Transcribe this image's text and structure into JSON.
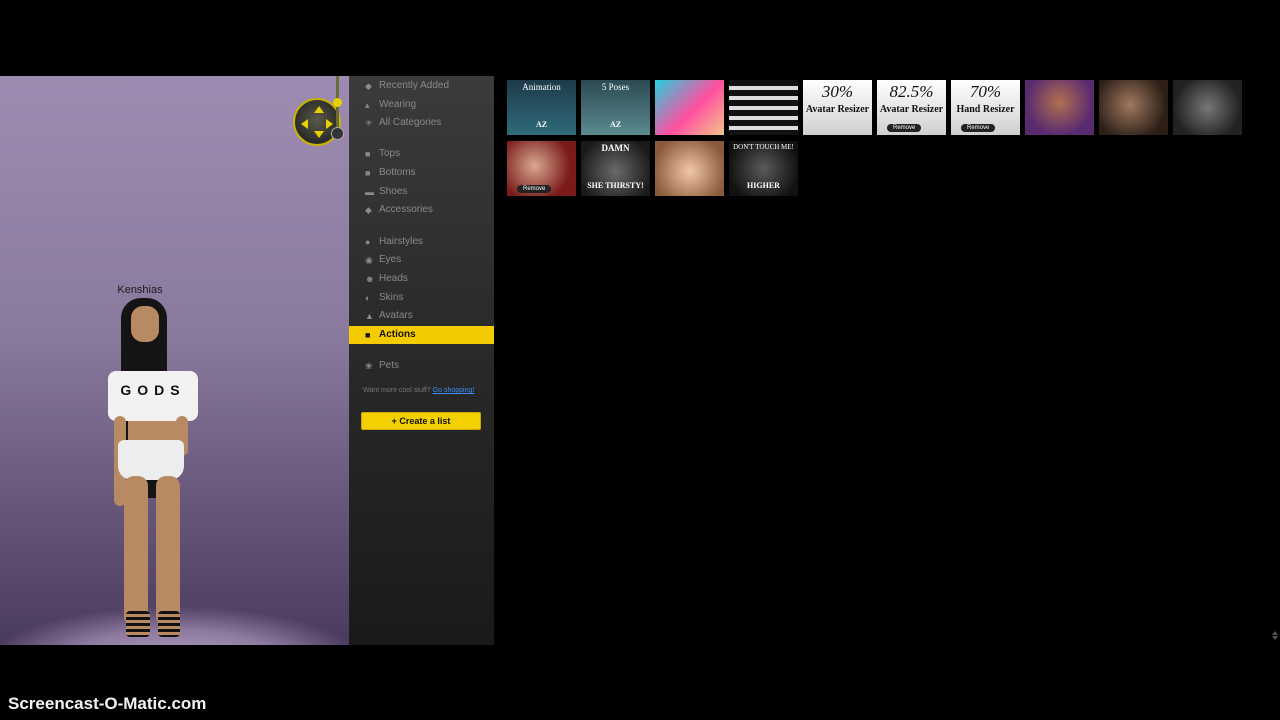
{
  "stage": {
    "avatar_name": "Kenshias",
    "shirt_text": "GODS"
  },
  "sidebar": {
    "items": [
      {
        "label": "Recently Added",
        "icon": "tag-icon"
      },
      {
        "label": "Wearing",
        "icon": "hanger-icon"
      },
      {
        "label": "All Categories",
        "icon": "asterisk-icon"
      },
      {
        "label": "Tops",
        "icon": "shirt-icon"
      },
      {
        "label": "Bottoms",
        "icon": "pants-icon"
      },
      {
        "label": "Shoes",
        "icon": "shoe-icon"
      },
      {
        "label": "Accessories",
        "icon": "diamond-icon"
      },
      {
        "label": "Hairstyles",
        "icon": "hair-icon"
      },
      {
        "label": "Eyes",
        "icon": "eye-icon"
      },
      {
        "label": "Heads",
        "icon": "face-icon"
      },
      {
        "label": "Skins",
        "icon": "skin-icon"
      },
      {
        "label": "Avatars",
        "icon": "person-icon"
      },
      {
        "label": "Actions",
        "icon": "clapper-icon",
        "active": true
      },
      {
        "label": "Pets",
        "icon": "paw-icon"
      }
    ],
    "shop_prompt": "Want more cool stuff?",
    "shop_link": "Go shopping!",
    "create_list_label": "Create a list",
    "create_list_icon": "+"
  },
  "grid": {
    "tiles": [
      {
        "caption": "Animation",
        "sub": "AZ"
      },
      {
        "caption": "5 Poses",
        "sub": "AZ"
      },
      {
        "caption": "",
        "sub": ""
      },
      {
        "caption": "",
        "sub": ""
      },
      {
        "caption": "30%",
        "sub": "Avatar Resizer"
      },
      {
        "caption": "82.5%",
        "sub": "Avatar Resizer",
        "remove": "Remove"
      },
      {
        "caption": "70%",
        "sub": "Hand Resizer",
        "remove": "Remove"
      },
      {
        "caption": "",
        "sub": ""
      },
      {
        "caption": "",
        "sub": ""
      },
      {
        "caption": "",
        "sub": ""
      },
      {
        "caption": "",
        "sub": "",
        "remove": "Remove"
      },
      {
        "caption": "DAMN",
        "sub": "SHE THIRSTY!"
      },
      {
        "caption": "",
        "sub": ""
      },
      {
        "caption": "DON'T TOUCH ME!",
        "sub": "HIGHER"
      }
    ]
  },
  "watermark": "Screencast-O-Matic.com",
  "colors": {
    "accent": "#f4cb00",
    "link": "#3c8ef0",
    "background": "#000000"
  }
}
